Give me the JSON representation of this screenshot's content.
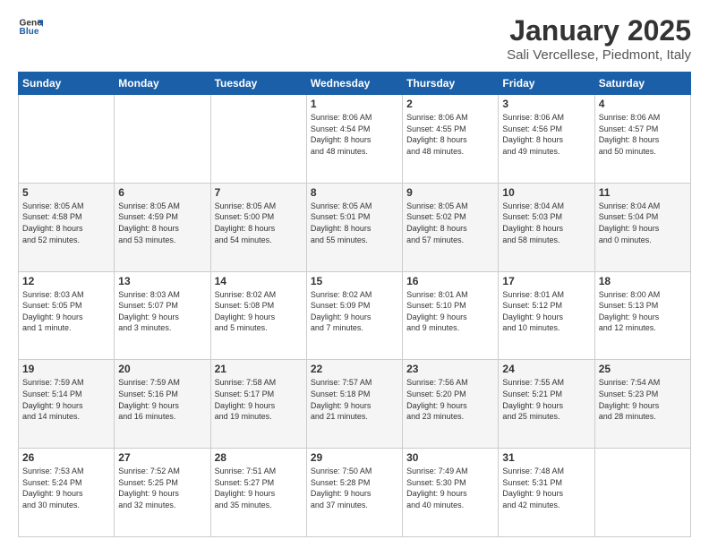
{
  "header": {
    "logo_line1": "General",
    "logo_line2": "Blue",
    "month": "January 2025",
    "location": "Sali Vercellese, Piedmont, Italy"
  },
  "weekdays": [
    "Sunday",
    "Monday",
    "Tuesday",
    "Wednesday",
    "Thursday",
    "Friday",
    "Saturday"
  ],
  "weeks": [
    [
      {
        "day": "",
        "info": ""
      },
      {
        "day": "",
        "info": ""
      },
      {
        "day": "",
        "info": ""
      },
      {
        "day": "1",
        "info": "Sunrise: 8:06 AM\nSunset: 4:54 PM\nDaylight: 8 hours\nand 48 minutes."
      },
      {
        "day": "2",
        "info": "Sunrise: 8:06 AM\nSunset: 4:55 PM\nDaylight: 8 hours\nand 48 minutes."
      },
      {
        "day": "3",
        "info": "Sunrise: 8:06 AM\nSunset: 4:56 PM\nDaylight: 8 hours\nand 49 minutes."
      },
      {
        "day": "4",
        "info": "Sunrise: 8:06 AM\nSunset: 4:57 PM\nDaylight: 8 hours\nand 50 minutes."
      }
    ],
    [
      {
        "day": "5",
        "info": "Sunrise: 8:05 AM\nSunset: 4:58 PM\nDaylight: 8 hours\nand 52 minutes."
      },
      {
        "day": "6",
        "info": "Sunrise: 8:05 AM\nSunset: 4:59 PM\nDaylight: 8 hours\nand 53 minutes."
      },
      {
        "day": "7",
        "info": "Sunrise: 8:05 AM\nSunset: 5:00 PM\nDaylight: 8 hours\nand 54 minutes."
      },
      {
        "day": "8",
        "info": "Sunrise: 8:05 AM\nSunset: 5:01 PM\nDaylight: 8 hours\nand 55 minutes."
      },
      {
        "day": "9",
        "info": "Sunrise: 8:05 AM\nSunset: 5:02 PM\nDaylight: 8 hours\nand 57 minutes."
      },
      {
        "day": "10",
        "info": "Sunrise: 8:04 AM\nSunset: 5:03 PM\nDaylight: 8 hours\nand 58 minutes."
      },
      {
        "day": "11",
        "info": "Sunrise: 8:04 AM\nSunset: 5:04 PM\nDaylight: 9 hours\nand 0 minutes."
      }
    ],
    [
      {
        "day": "12",
        "info": "Sunrise: 8:03 AM\nSunset: 5:05 PM\nDaylight: 9 hours\nand 1 minute."
      },
      {
        "day": "13",
        "info": "Sunrise: 8:03 AM\nSunset: 5:07 PM\nDaylight: 9 hours\nand 3 minutes."
      },
      {
        "day": "14",
        "info": "Sunrise: 8:02 AM\nSunset: 5:08 PM\nDaylight: 9 hours\nand 5 minutes."
      },
      {
        "day": "15",
        "info": "Sunrise: 8:02 AM\nSunset: 5:09 PM\nDaylight: 9 hours\nand 7 minutes."
      },
      {
        "day": "16",
        "info": "Sunrise: 8:01 AM\nSunset: 5:10 PM\nDaylight: 9 hours\nand 9 minutes."
      },
      {
        "day": "17",
        "info": "Sunrise: 8:01 AM\nSunset: 5:12 PM\nDaylight: 9 hours\nand 10 minutes."
      },
      {
        "day": "18",
        "info": "Sunrise: 8:00 AM\nSunset: 5:13 PM\nDaylight: 9 hours\nand 12 minutes."
      }
    ],
    [
      {
        "day": "19",
        "info": "Sunrise: 7:59 AM\nSunset: 5:14 PM\nDaylight: 9 hours\nand 14 minutes."
      },
      {
        "day": "20",
        "info": "Sunrise: 7:59 AM\nSunset: 5:16 PM\nDaylight: 9 hours\nand 16 minutes."
      },
      {
        "day": "21",
        "info": "Sunrise: 7:58 AM\nSunset: 5:17 PM\nDaylight: 9 hours\nand 19 minutes."
      },
      {
        "day": "22",
        "info": "Sunrise: 7:57 AM\nSunset: 5:18 PM\nDaylight: 9 hours\nand 21 minutes."
      },
      {
        "day": "23",
        "info": "Sunrise: 7:56 AM\nSunset: 5:20 PM\nDaylight: 9 hours\nand 23 minutes."
      },
      {
        "day": "24",
        "info": "Sunrise: 7:55 AM\nSunset: 5:21 PM\nDaylight: 9 hours\nand 25 minutes."
      },
      {
        "day": "25",
        "info": "Sunrise: 7:54 AM\nSunset: 5:23 PM\nDaylight: 9 hours\nand 28 minutes."
      }
    ],
    [
      {
        "day": "26",
        "info": "Sunrise: 7:53 AM\nSunset: 5:24 PM\nDaylight: 9 hours\nand 30 minutes."
      },
      {
        "day": "27",
        "info": "Sunrise: 7:52 AM\nSunset: 5:25 PM\nDaylight: 9 hours\nand 32 minutes."
      },
      {
        "day": "28",
        "info": "Sunrise: 7:51 AM\nSunset: 5:27 PM\nDaylight: 9 hours\nand 35 minutes."
      },
      {
        "day": "29",
        "info": "Sunrise: 7:50 AM\nSunset: 5:28 PM\nDaylight: 9 hours\nand 37 minutes."
      },
      {
        "day": "30",
        "info": "Sunrise: 7:49 AM\nSunset: 5:30 PM\nDaylight: 9 hours\nand 40 minutes."
      },
      {
        "day": "31",
        "info": "Sunrise: 7:48 AM\nSunset: 5:31 PM\nDaylight: 9 hours\nand 42 minutes."
      },
      {
        "day": "",
        "info": ""
      }
    ]
  ]
}
